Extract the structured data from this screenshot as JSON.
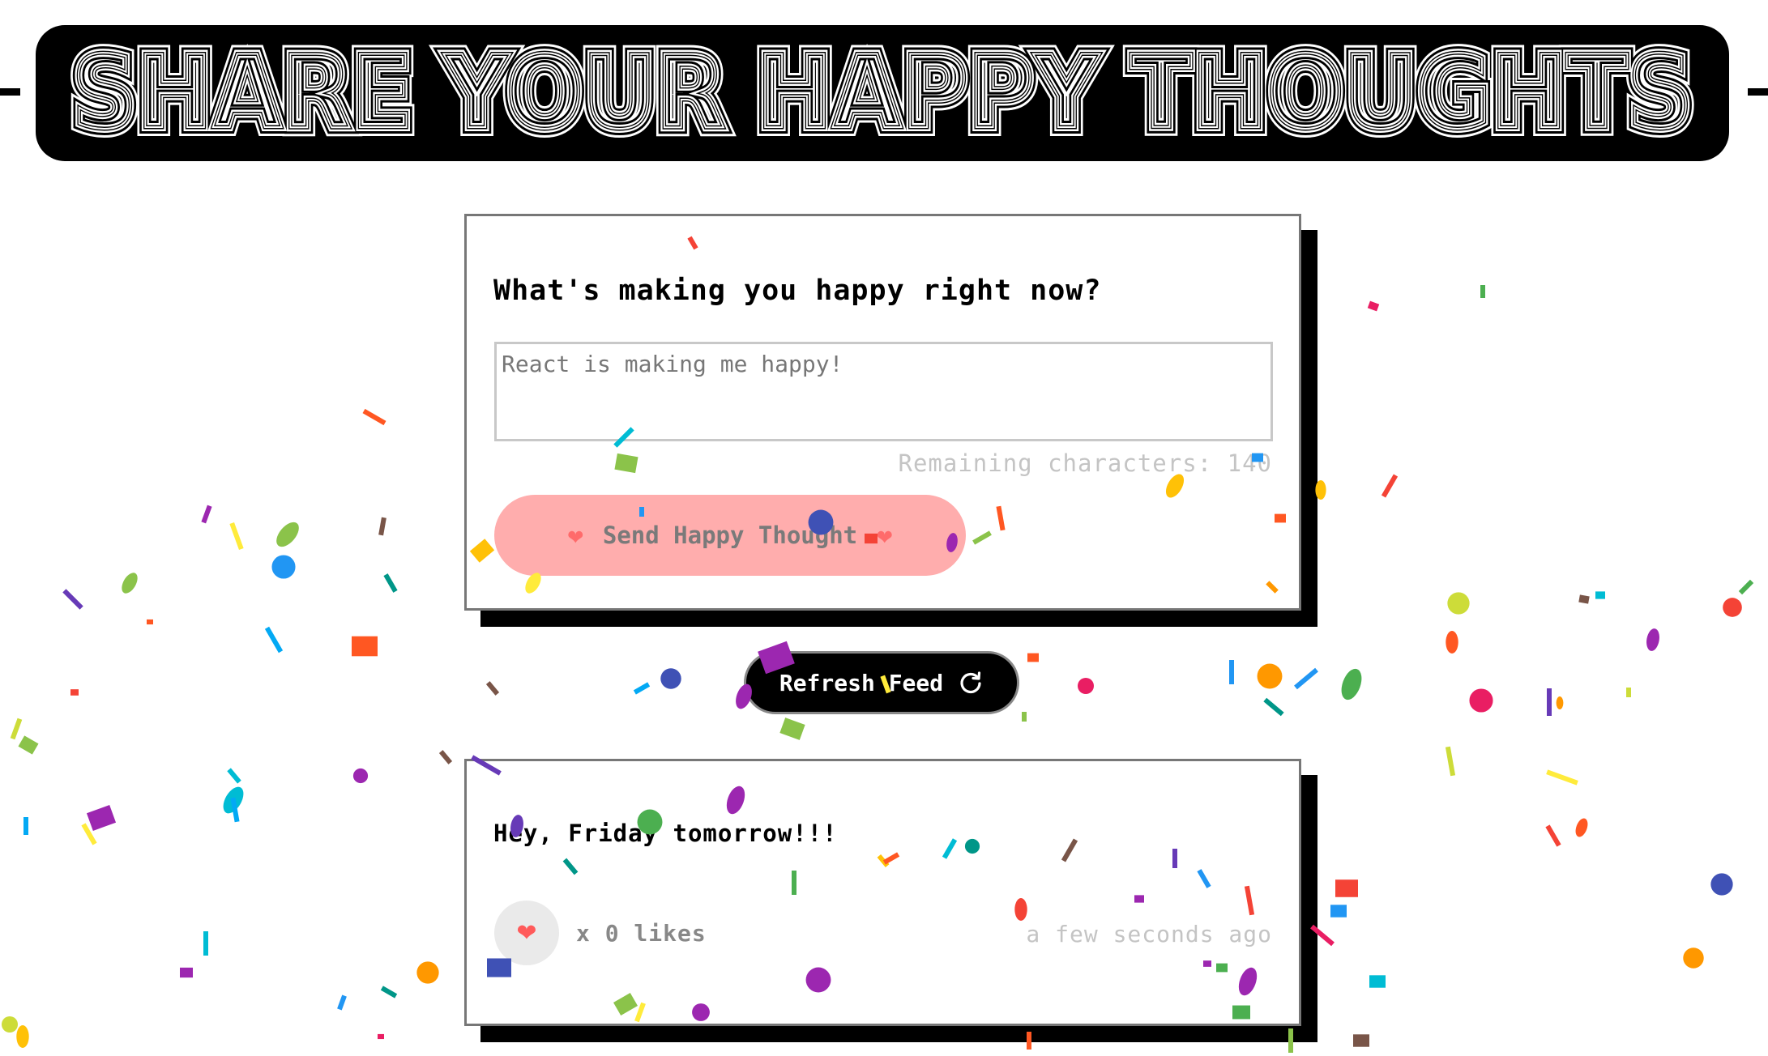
{
  "header": {
    "title": "SHARE YOUR HAPPY THOUGHTS"
  },
  "form": {
    "title": "What's making you happy right now?",
    "input_value": "",
    "input_placeholder": "React is making me happy!",
    "remaining_label": "Remaining characters: 140",
    "remaining_count": 140,
    "send_label": "Send Happy Thought",
    "send_icon": "heart-icon"
  },
  "refresh": {
    "label": "Refresh Feed",
    "icon": "refresh-icon"
  },
  "thoughts": [
    {
      "message": "Hey, Friday tomorrow!!!",
      "likes_label": "x 0 likes",
      "likes": 0,
      "time": "a few seconds ago",
      "like_icon": "heart-icon"
    }
  ],
  "colors": {
    "send_button_bg": "#ffadad",
    "card_shadow": "#000000",
    "header_bg": "#000000",
    "confetti": [
      "#f44336",
      "#e91e63",
      "#9c27b0",
      "#673ab7",
      "#3f51b5",
      "#2196f3",
      "#03a9f4",
      "#00bcd4",
      "#009688",
      "#4caf50",
      "#8bc34a",
      "#cddc39",
      "#ffeb3b",
      "#ffc107",
      "#ff9800",
      "#ff5722",
      "#795548"
    ]
  }
}
